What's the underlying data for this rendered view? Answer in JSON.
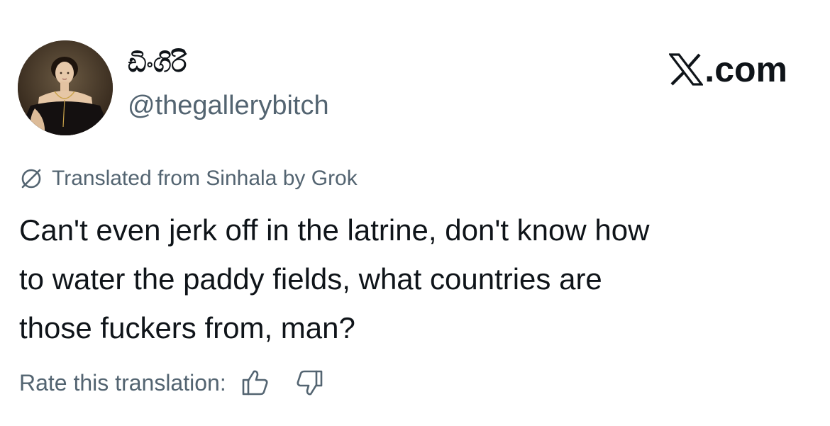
{
  "author": {
    "display_name": "ඩිංගිරි",
    "handle": "@thegallerybitch",
    "avatar_icon": "portrait-painting-avatar"
  },
  "brand": {
    "text": ".com",
    "icon": "x-logo-icon"
  },
  "translation": {
    "notice": "Translated from Sinhala by Grok",
    "icon": "translate-icon"
  },
  "tweet": {
    "lines": [
      "Can't even jerk off in the latrine, don't know how",
      "to water the paddy fields, what countries are",
      "those fuckers from, man?"
    ]
  },
  "rating": {
    "label": "Rate this translation:",
    "thumbs_up_icon": "thumbs-up-icon",
    "thumbs_down_icon": "thumbs-down-icon"
  },
  "colors": {
    "text_primary": "#0f1419",
    "text_secondary": "#536471",
    "background": "#ffffff"
  }
}
